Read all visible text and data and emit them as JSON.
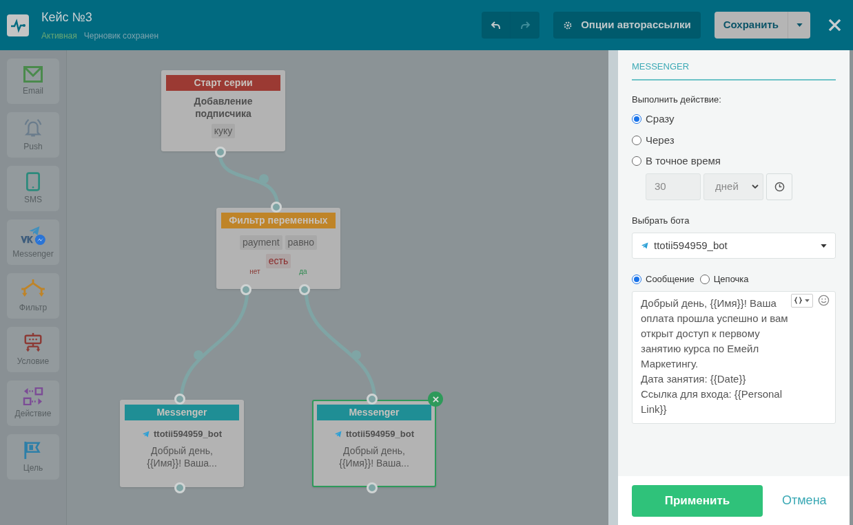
{
  "header": {
    "title": "Кейс №3",
    "status": "Активная",
    "save_state": "Черновик сохранен",
    "undo": {
      "disabled": false
    },
    "redo": {
      "disabled": true
    },
    "options_button": "Опции авторассылки",
    "save_button": "Сохранить"
  },
  "palette": [
    {
      "kind": "email",
      "label": "Email"
    },
    {
      "kind": "push",
      "label": "Push"
    },
    {
      "kind": "sms",
      "label": "SMS"
    },
    {
      "kind": "messenger",
      "label": "Messenger"
    },
    {
      "kind": "filter",
      "label": "Фильтр"
    },
    {
      "kind": "condition",
      "label": "Условие"
    },
    {
      "kind": "action",
      "label": "Действие"
    },
    {
      "kind": "goal",
      "label": "Цель"
    }
  ],
  "nodes": [
    {
      "kind": "start",
      "header": "Старт серии",
      "title": "Добавление подписчика",
      "tags": [
        {
          "kind": "field",
          "text": "куку"
        }
      ]
    },
    {
      "kind": "filter",
      "header": "Фильтр переменных",
      "tags": [
        {
          "kind": "field",
          "text": "payment"
        },
        {
          "kind": "field",
          "text": "равно"
        },
        {
          "kind": "value",
          "text": "есть"
        }
      ],
      "outputs": [
        {
          "kind": "no",
          "label": "нет"
        },
        {
          "kind": "yes",
          "label": "да"
        }
      ]
    },
    {
      "kind": "messenger",
      "header": "Messenger",
      "bot": "ttotii594959_bot",
      "preview": "Добрый день, {{Имя}}! Ваша...",
      "selected": false
    },
    {
      "kind": "messenger",
      "header": "Messenger",
      "bot": "ttotii594959_bot",
      "preview": "Добрый день, {{Имя}}! Ваша...",
      "selected": true
    }
  ],
  "panel": {
    "section_title": "MESSENGER",
    "timing_label": "Выполнить действие:",
    "timing_options": [
      {
        "label": "Сразу",
        "selected": true
      },
      {
        "label": "Через",
        "selected": false
      },
      {
        "label": "В точное время",
        "selected": false
      }
    ],
    "delay_value": {
      "value": "30",
      "disabled": true
    },
    "delay_unit": {
      "value": "дней",
      "disabled": true
    },
    "bot_label": "Выбрать бота",
    "bot_select": "ttotii594959_bot",
    "message_modes": [
      {
        "label": "Сообщение",
        "selected": true
      },
      {
        "label": "Цепочка",
        "selected": false
      }
    ],
    "message": "Добрый день, {{Имя}}! Ваша оплата прошла успешно и вам открыт доступ к первому занятию курса по Емейл Маркетингу.\nДата занятия: {{Date}}\nСсылка для входа: {{Personal Link}}",
    "apply_button": "Применить",
    "cancel_button": "Отмена"
  }
}
